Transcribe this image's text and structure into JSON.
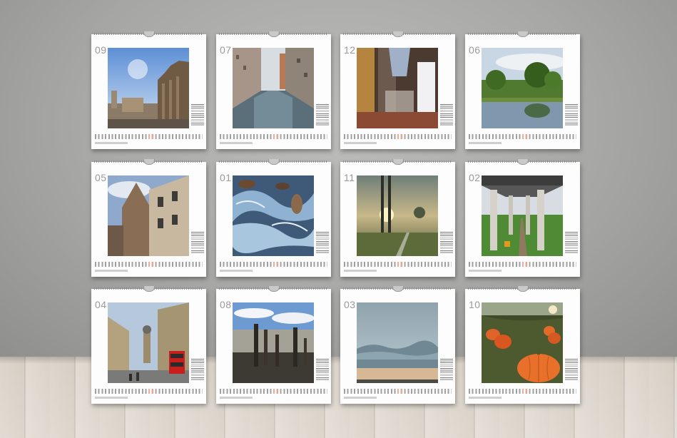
{
  "calendar_pages": [
    {
      "month": "09",
      "scene": "city-ruins-photo"
    },
    {
      "month": "07",
      "scene": "canal-photo"
    },
    {
      "month": "12",
      "scene": "church-interior-photo"
    },
    {
      "month": "06",
      "scene": "pond-trees-photo"
    },
    {
      "month": "05",
      "scene": "old-tower-photo"
    },
    {
      "month": "01",
      "scene": "ice-leaves-photo"
    },
    {
      "month": "11",
      "scene": "misty-sunrise-photo"
    },
    {
      "month": "02",
      "scene": "bridge-pillars-photo"
    },
    {
      "month": "04",
      "scene": "london-street-photo"
    },
    {
      "month": "08",
      "scene": "wooden-posts-shore-photo"
    },
    {
      "month": "03",
      "scene": "cloud-bank-photo"
    },
    {
      "month": "10",
      "scene": "pumpkin-field-photo"
    }
  ]
}
